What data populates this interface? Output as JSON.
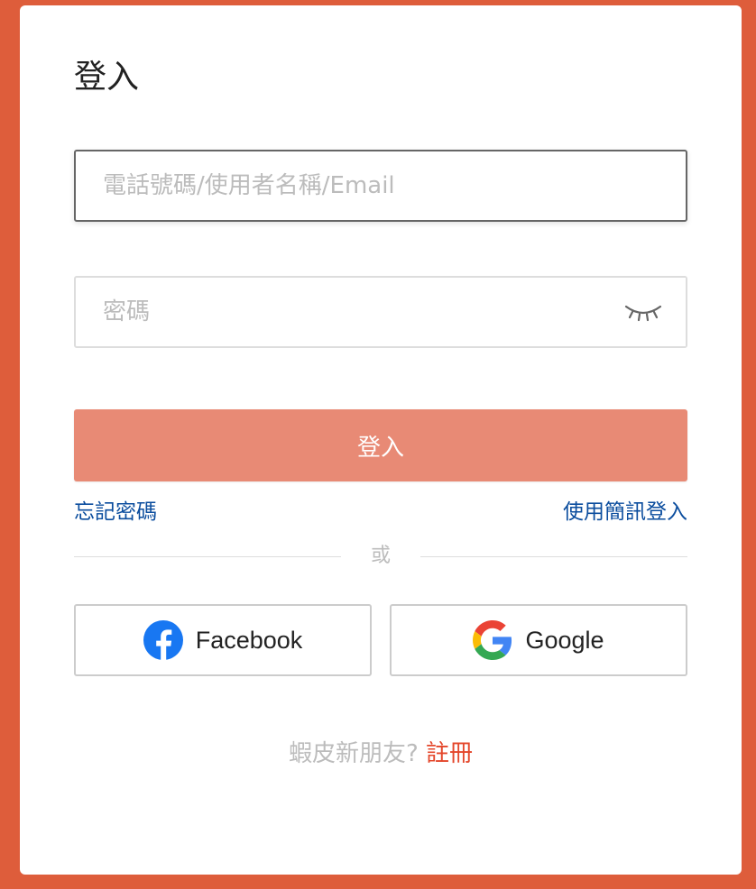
{
  "login": {
    "title": "登入",
    "username_placeholder": "電話號碼/使用者名稱/Email",
    "password_placeholder": "密碼",
    "submit_label": "登入",
    "forgot_password": "忘記密碼",
    "sms_login": "使用簡訊登入",
    "divider": "或"
  },
  "social": {
    "facebook_label": "Facebook",
    "google_label": "Google"
  },
  "signup": {
    "prompt": "蝦皮新朋友?",
    "link": "註冊"
  },
  "colors": {
    "background": "#de5d3b",
    "button": "#e88a75",
    "link": "#0b4d9e",
    "register": "#e4472b"
  },
  "icons": [
    "eye-closed-icon",
    "facebook-icon",
    "google-icon"
  ]
}
